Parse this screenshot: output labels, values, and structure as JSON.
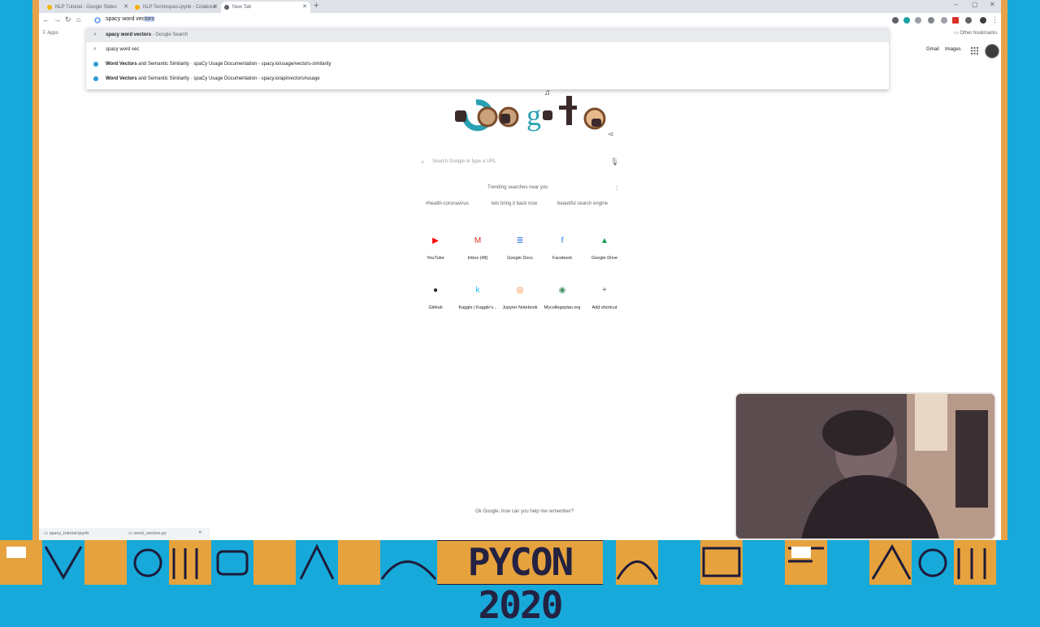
{
  "browser": {
    "tabs": [
      {
        "label": "NLP Tutorial - Google Slides",
        "active": false,
        "favicon_color": "#f4b400"
      },
      {
        "label": "NLP Techniques.ipynb - Colabora",
        "active": false,
        "favicon_color": "#f9ab00"
      },
      {
        "label": "New Tab",
        "active": true,
        "favicon_color": "#5f6368"
      }
    ],
    "new_tab_glyph": "+",
    "window_controls": {
      "minimize": "–",
      "maximize": "▢",
      "close": "✕"
    },
    "nav": {
      "back": "←",
      "forward": "→",
      "reload": "↻",
      "home": "⌂"
    },
    "omnibox": {
      "typed": "spacy word vec",
      "autocomplete": "tors"
    },
    "bookmarks": {
      "apps": "Apps",
      "other": "Other bookmarks"
    },
    "suggestions": [
      {
        "icon": "search-icon",
        "bold": "spacy word vectors",
        "rest": " - Google Search",
        "highlight": true
      },
      {
        "icon": "search-icon",
        "bold": "",
        "rest": "spacy word vec",
        "highlight": false
      },
      {
        "icon": "globe-icon",
        "bold": "Word Vectors",
        "rest": " and Semantic Similarity · spaCy Usage Documentation - spacy.io/usage/vectors-similarity",
        "highlight": false
      },
      {
        "icon": "globe-icon",
        "bold": "Word Vectors",
        "rest": " and Semantic Similarity · spaCy Usage Documentation - spacy.io/api/vectors#usage",
        "highlight": false
      }
    ]
  },
  "google": {
    "top_links": {
      "gmail": "Gmail",
      "images": "Images"
    },
    "search_placeholder": "Search Google or type a URL",
    "trending": "Trending searches near you",
    "chips": [
      "#health-coronavirus",
      "lets bring it back now",
      "beautiful search engine"
    ],
    "shortcuts": [
      {
        "label": "YouTube",
        "icon": "youtube-icon",
        "glyph": "▶",
        "color": "#ff0000"
      },
      {
        "label": "Inbox (48)",
        "icon": "gmail-icon",
        "glyph": "M",
        "color": "#d93025"
      },
      {
        "label": "Google Docs",
        "icon": "docs-icon",
        "glyph": "≣",
        "color": "#4285f4"
      },
      {
        "label": "Facebook",
        "icon": "facebook-icon",
        "glyph": "f",
        "color": "#1877f2"
      },
      {
        "label": "Google Drive",
        "icon": "drive-icon",
        "glyph": "▲",
        "color": "#0f9d58"
      },
      {
        "label": "GitHub",
        "icon": "github-icon",
        "glyph": "●",
        "color": "#24292e"
      },
      {
        "label": "Kaggle | Kaggle's...",
        "icon": "kaggle-icon",
        "glyph": "k",
        "color": "#20beff"
      },
      {
        "label": "Jupyter Notebook",
        "icon": "jupyter-icon",
        "glyph": "◎",
        "color": "#f37626"
      },
      {
        "label": "Mycollegeplan.org",
        "icon": "site-icon",
        "glyph": "◉",
        "color": "#3a8f5f"
      },
      {
        "label": "Add shortcut",
        "icon": "plus-icon",
        "glyph": "+",
        "color": "#5f6368"
      }
    ],
    "footer": "Ok Google, how can you help me remember?"
  },
  "downloads": [
    {
      "label": "spacy_tutorial.ipynb"
    },
    {
      "label": "word_vectors.py"
    }
  ],
  "banner": {
    "title": "PYCON 2020"
  },
  "colors": {
    "frame_blue": "#17a9d9",
    "frame_orange": "#e9a24a",
    "banner_dark": "#1d1b3a",
    "banner_gold": "#e6a23c"
  }
}
